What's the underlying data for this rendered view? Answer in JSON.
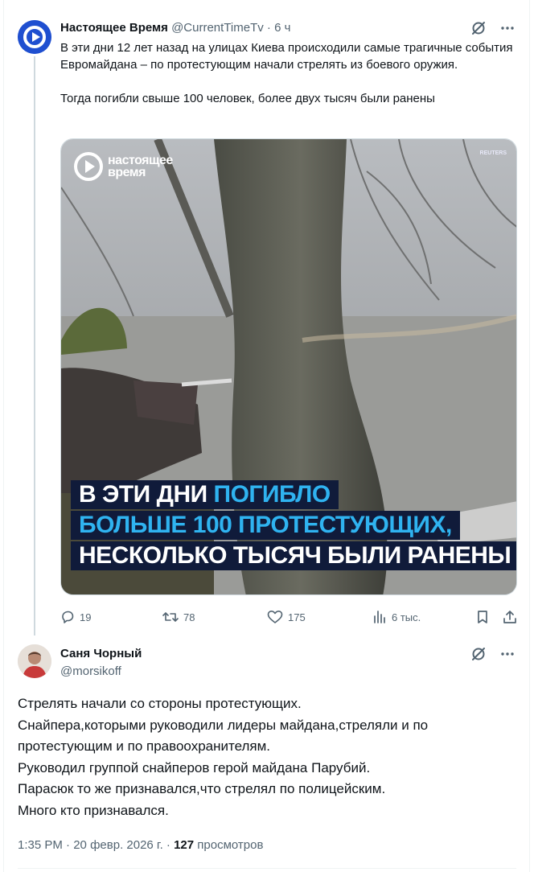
{
  "tweet1": {
    "author_name": "Настоящее Время",
    "author_handle": "@CurrentTimeTv",
    "time": "6 ч",
    "separator": "·",
    "text": "В эти дни 12 лет назад на улицах Киева происходили самые трагичные события Евромайдана – по протестующим начали стрелять из боевого оружия.\n\nТогда погибли свыше 100 человек, более двух тысяч были ранены",
    "media": {
      "logo_text": "Настоящее Время",
      "watermark": "REUTERS",
      "caption": {
        "line1_white": "В ЭТИ ДНИ ",
        "line1_accent": "ПОГИБЛО",
        "line2": "БОЛЬШЕ 100 ПРОТЕСТУЮЩИХ,",
        "line3": "НЕСКОЛЬКО ТЫСЯЧ БЫЛИ РАНЕНЫ"
      }
    },
    "actions": {
      "replies": "19",
      "retweets": "78",
      "likes": "175",
      "views": "6 тыс."
    }
  },
  "tweet2": {
    "author_name": "Саня Чорный",
    "author_handle": "@morsikoff",
    "lines": [
      "Стрелять начали со стороны протестующих.",
      "Снайпера,которыми руководили лидеры майдана,стреляли и по",
      "протестующим и по правоохранителям.",
      "Руководил группой снайперов герой майдана Парубий.",
      "Парасюк то же признавался,что стрелял по полицейским.",
      "Много кто признавался."
    ],
    "meta": {
      "time": "1:35 PM",
      "date": "20 февр. 2026 г.",
      "separator": "·",
      "views_count": "127",
      "views_label": "просмотров"
    }
  },
  "icons": {
    "grok": "slashed-circle-icon",
    "more": "more-dots-icon",
    "reply": "reply-bubble-icon",
    "retweet": "retweet-icon",
    "like": "heart-icon",
    "views": "views-bars-icon",
    "bookmark": "bookmark-icon",
    "share": "share-icon"
  },
  "colors": {
    "brand_blue": "#1f4fd0",
    "secondary_text": "#536471",
    "caption_accent": "#2fb3f0",
    "caption_bg": "#101b3a"
  }
}
